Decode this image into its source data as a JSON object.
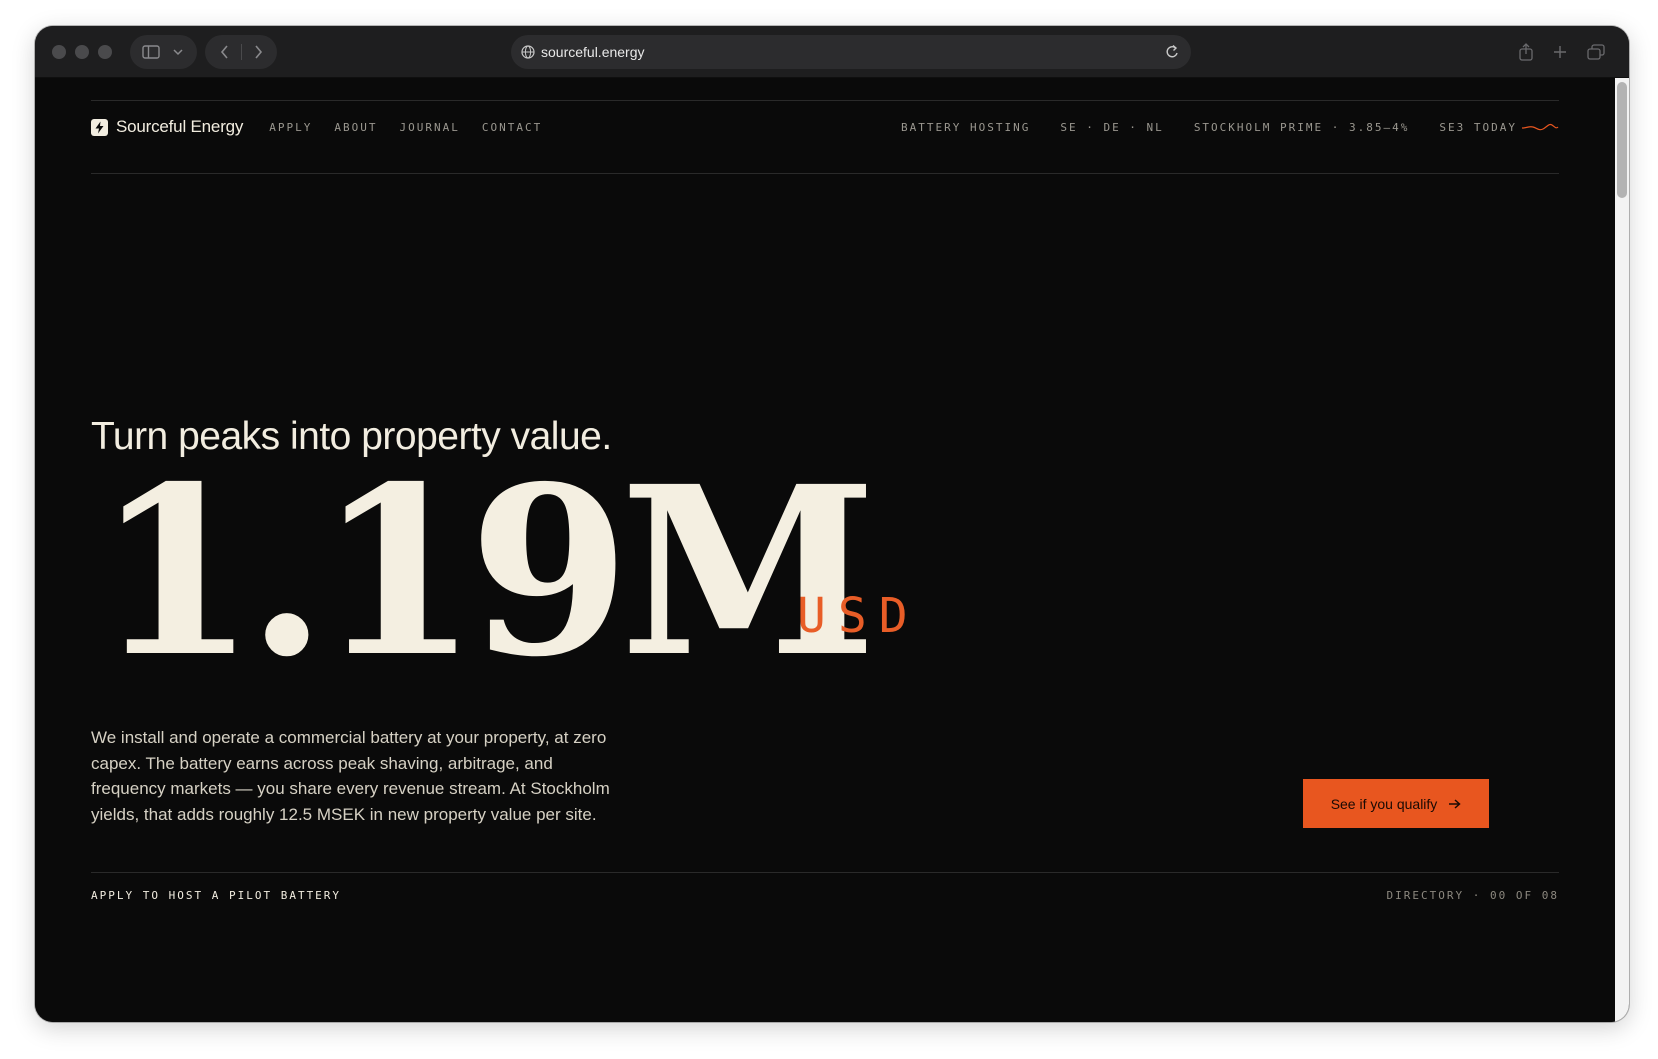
{
  "browser": {
    "url": "sourceful.energy"
  },
  "header": {
    "brand": "Sourceful Energy",
    "nav": [
      "APPLY",
      "ABOUT",
      "JOURNAL",
      "CONTACT"
    ],
    "tags": {
      "service": "BATTERY HOSTING",
      "regions": "SE · DE · NL",
      "yield": "STOCKHOLM PRIME · 3.85–4%",
      "today": "SE3 TODAY"
    }
  },
  "hero": {
    "headline": "Turn peaks into property value.",
    "value": "1.19M",
    "unit": "USD",
    "description": "We install and operate a commercial battery at your property, at zero capex. The battery earns across peak shaving, arbitrage, and frequency markets — you share every revenue stream. At Stockholm yields, that adds roughly 12.5 MSEK in new property value per site.",
    "cta": "See if you qualify"
  },
  "footer": {
    "left": "APPLY TO HOST A PILOT BATTERY",
    "right": "DIRECTORY · 00 OF 08"
  },
  "colors": {
    "background": "#0a0a0a",
    "cream": "#f4efe1",
    "accent": "#e8561f"
  }
}
